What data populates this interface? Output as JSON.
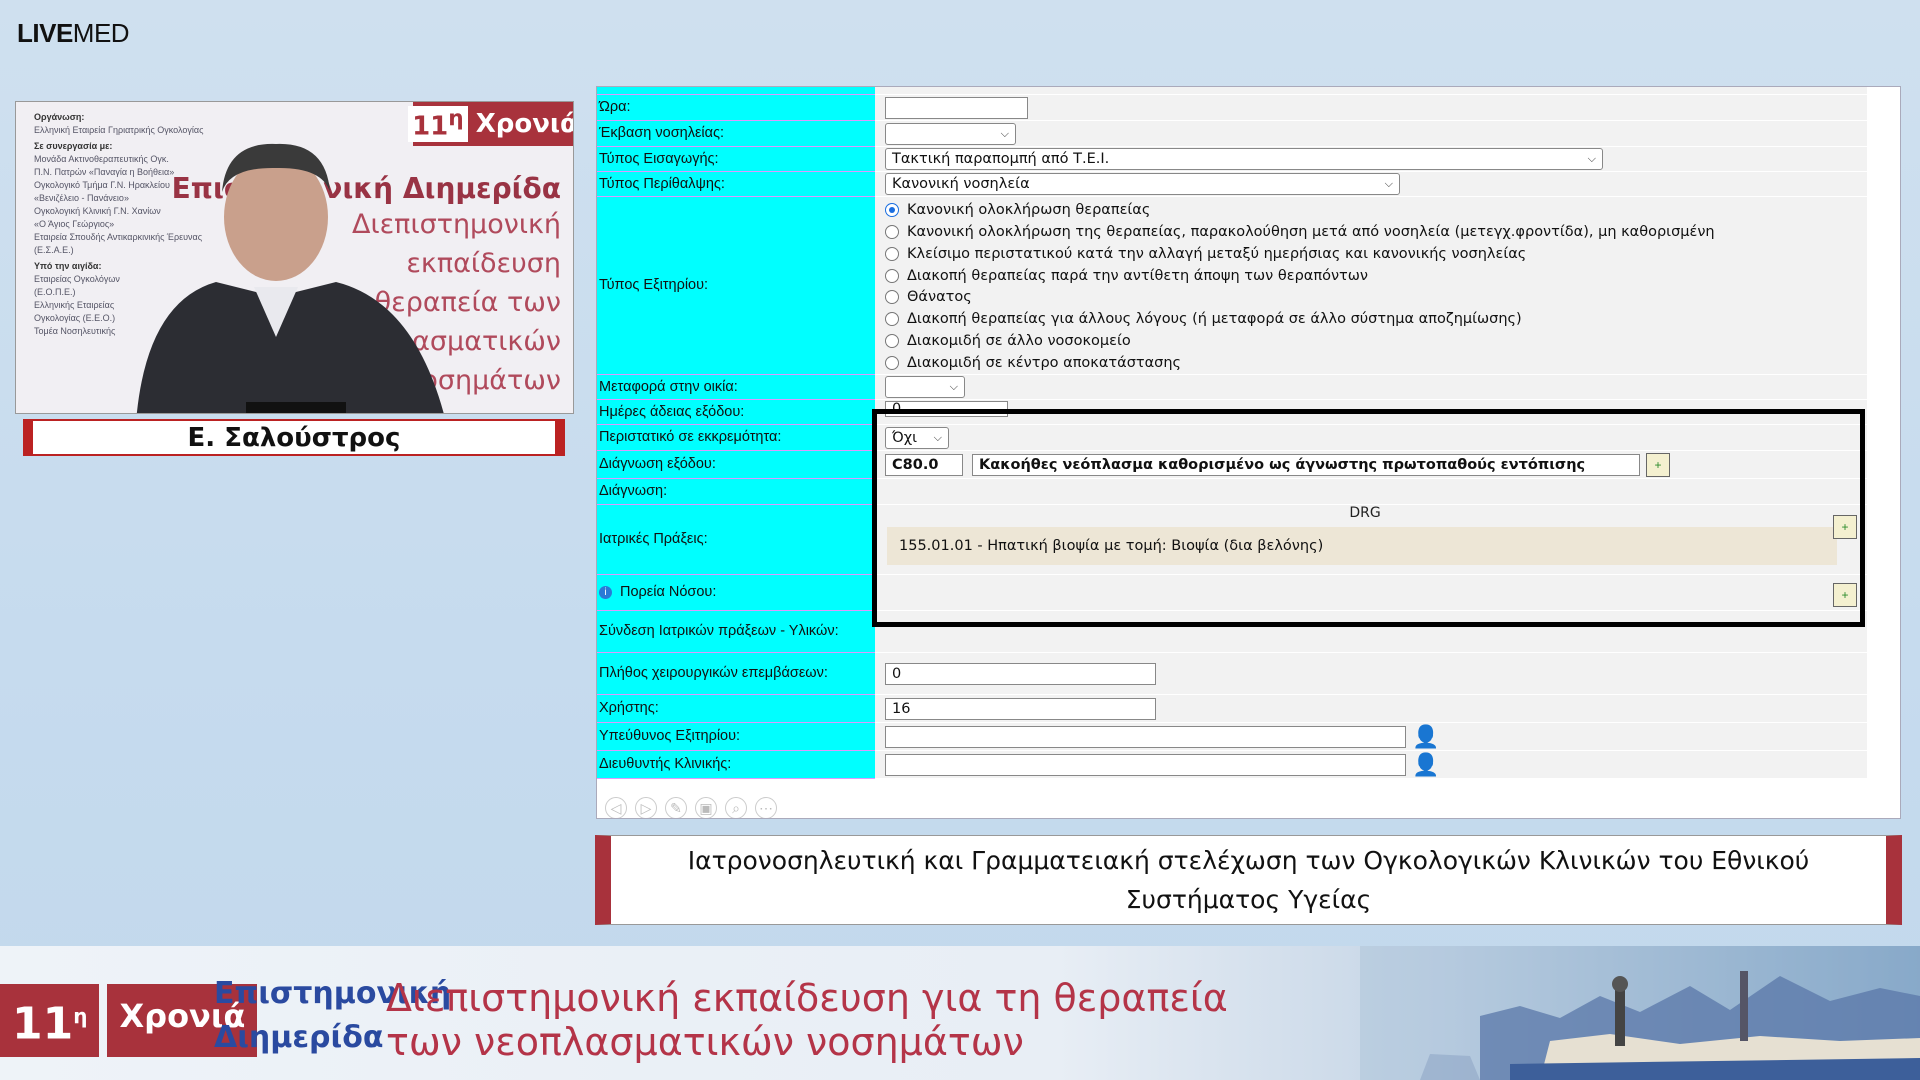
{
  "brand": {
    "live": "LIVE",
    "med": "MED"
  },
  "video": {
    "org_label": "Οργάνωση:",
    "org_text": "Ελληνική Εταιρεία Γηριατρικής Ογκολογίας",
    "coop_label": "Σε συνεργασία με:",
    "coop_items": [
      "Μονάδα Ακτινοθεραπευτικής Ογκ.",
      "Π.Ν. Πατρών «Παναγία η Βοήθεια»",
      "Ογκολογικό Τμήμα Γ.Ν. Ηρακλείου",
      "«Βενιζέλειο - Πανάνειο»",
      "Ογκολογική Κλινική Γ.Ν. Χανίων",
      "«Ο Άγιος Γεώργιος»",
      "Εταιρεία Σπουδής Αντικαρκινικής Έρευνας",
      "(Ε.Σ.Α.Ε.)"
    ],
    "aegis_label": "Υπό την αιγίδα:",
    "aegis_items": [
      "Εταιρείας Ογκολόγων",
      "(Ε.Ο.Π.Ε.)",
      "Ελληνικής Εταιρείας",
      "Ογκολογίας (Ε.Ε.Ο.)",
      "Τομέα Νοσηλευτικής"
    ],
    "badge_num": "11",
    "badge_sup": "η",
    "badge_word": "Χρονιά",
    "title1": "Επιστημονική Διημερίδα",
    "title_lines": [
      "Διεπιστημονική",
      "εκπαίδευση",
      "θεραπεία των",
      "νεοπλασματικών",
      "νοσημάτων"
    ]
  },
  "speaker": "Ε. Σαλούστρος",
  "form": {
    "rows": [
      {
        "label": "Ώρα:"
      },
      {
        "label": "Έκβαση νοσηλείας:"
      },
      {
        "label": "Τύπος Εισαγωγής:",
        "value": "Τακτική παραπομπή από Τ.Ε.Ι."
      },
      {
        "label": "Τύπος Περίθαλψης:",
        "value": "Κανονική νοσηλεία"
      },
      {
        "label": "Τύπος Εξιτηρίου:"
      },
      {
        "label": "Μεταφορά στην οικία:"
      },
      {
        "label": "Ημέρες άδειας εξόδου:",
        "value": "0"
      },
      {
        "label": "Περιστατικό σε εκκρεμότητα:",
        "value": "Όχι"
      },
      {
        "label": "Διάγνωση εξόδου:",
        "code": "C80.0",
        "desc": "Κακοήθες νεόπλασμα καθορισμένο ως άγνωστης πρωτοπαθούς εντόπισης"
      },
      {
        "label": "Διάγνωση:"
      },
      {
        "label": "Ιατρικές Πράξεις:"
      },
      {
        "label": "Πορεία Νόσου:"
      },
      {
        "label": "Σύνδεση Ιατρικών πράξεων - Υλικών:"
      },
      {
        "label": "Πλήθος χειρουργικών επεμβάσεων:",
        "value": "0"
      },
      {
        "label": "Χρήστης:",
        "value": "16"
      },
      {
        "label": "Υπεύθυνος Εξιτηρίου:"
      },
      {
        "label": "Διευθυντής Κλινικής:"
      }
    ],
    "exit_options": [
      {
        "text": "Κανονική ολοκλήρωση θεραπείας",
        "checked": true
      },
      {
        "text": "Κανονική ολοκλήρωση της θεραπείας, παρακολούθηση μετά από νοσηλεία (μετεγχ.φροντίδα), μη καθορισμένη",
        "checked": false
      },
      {
        "text": "Κλείσιμο περιστατικού κατά την αλλαγή μεταξύ ημερήσιας και κανονικής νοσηλείας",
        "checked": false
      },
      {
        "text": "Διακοπή θεραπείας παρά την αντίθετη άποψη των θεραπόντων",
        "checked": false
      },
      {
        "text": "Θάνατος",
        "checked": false
      },
      {
        "text": "Διακοπή θεραπείας για άλλους λόγους (ή μεταφορά σε άλλο σύστημα αποζημίωσης)",
        "checked": false
      },
      {
        "text": "Διακομιδή σε άλλο νοσοκομείο",
        "checked": false
      },
      {
        "text": "Διακομιδή σε κέντρο αποκατάστασης",
        "checked": false
      }
    ],
    "drg_label": "DRG",
    "procedure": "155.01.01 - Ηπατική βιοψία με τομή: Βιοψία (δια βελόνης)"
  },
  "caption": "Ιατρονοσηλευτική και Γραμματειακή στελέχωση των Ογκολογικών Κλινικών του Εθνικού Συστήματος Υγείας",
  "banner": {
    "num": "11",
    "sup": "η",
    "word": "Χρονιά",
    "sub1": "Επιστημονική",
    "sub2": "Διημερίδα",
    "line1": "Διεπιστημονική εκπαίδευση για τη θεραπεία",
    "line2": "των νεοπλασματικών νοσημάτων"
  }
}
